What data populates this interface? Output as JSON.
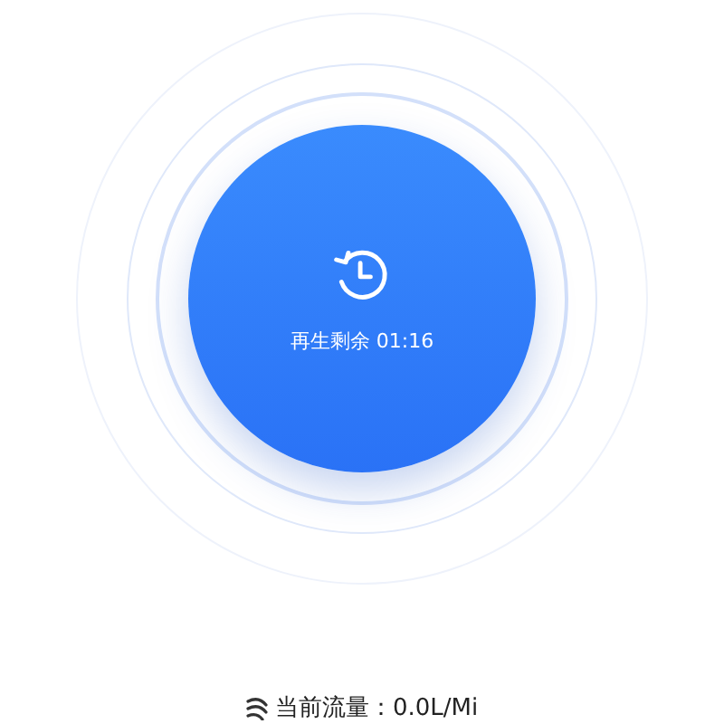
{
  "timer": {
    "label": "再生剩余 01:16"
  },
  "flow": {
    "label": "当前流量：0.0L/Mi"
  }
}
